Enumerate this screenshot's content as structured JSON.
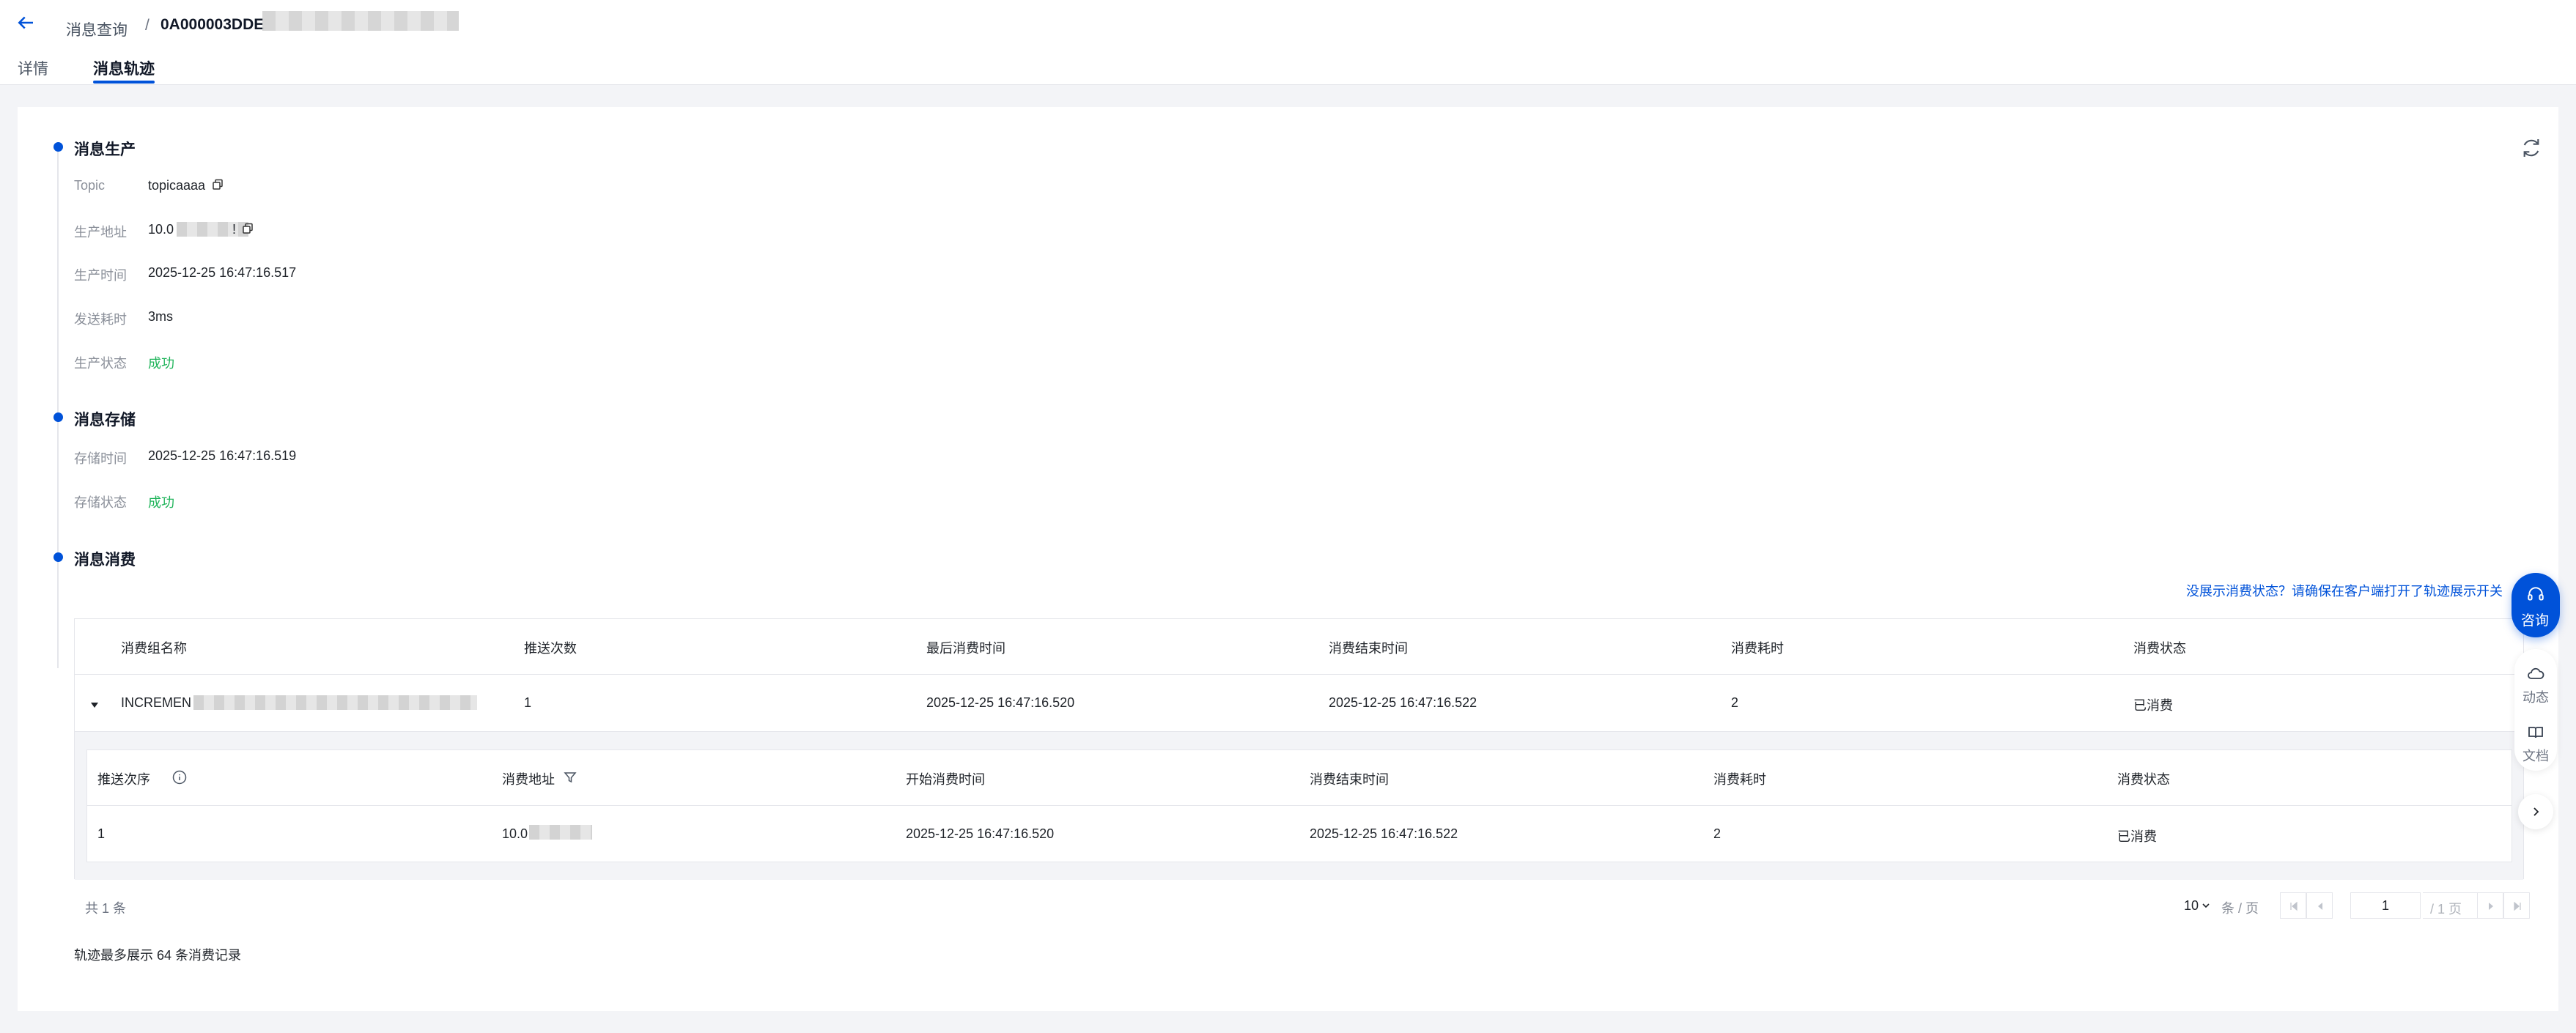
{
  "header": {
    "breadcrumb_parent": "消息查询",
    "breadcrumb_sep": "/",
    "breadcrumb_current": "0A000003DDE",
    "tabs": [
      {
        "label": "详情",
        "active": false
      },
      {
        "label": "消息轨迹",
        "active": true
      }
    ]
  },
  "produce": {
    "title": "消息生产",
    "topic_label": "Topic",
    "topic_value": "topicaaaa",
    "address_label": "生产地址",
    "address_value": "10.0",
    "address_suffix": "!",
    "time_label": "生产时间",
    "time_value": "2025-12-25 16:47:16.517",
    "cost_label": "发送耗时",
    "cost_value": "3ms",
    "status_label": "生产状态",
    "status_value": "成功"
  },
  "store": {
    "title": "消息存储",
    "time_label": "存储时间",
    "time_value": "2025-12-25 16:47:16.519",
    "status_label": "存储状态",
    "status_value": "成功"
  },
  "consume": {
    "title": "消息消费",
    "hint_link": "没展示消费状态？请确保在客户端打开了轨迹展示开关",
    "columns": [
      "消费组名称",
      "推送次数",
      "最后消费时间",
      "消费结束时间",
      "消费耗时",
      "消费状态"
    ],
    "row": {
      "group": "INCREMEN",
      "push_count": "1",
      "last_time": "2025-12-25 16:47:16.520",
      "end_time": "2025-12-25 16:47:16.522",
      "cost": "2",
      "status": "已消费"
    },
    "sub_columns": [
      "推送次序",
      "消费地址",
      "开始消费时间",
      "消费结束时间",
      "消费耗时",
      "消费状态"
    ],
    "sub_row": {
      "order": "1",
      "address": "10.0",
      "start_time": "2025-12-25 16:47:16.520",
      "end_time": "2025-12-25 16:47:16.522",
      "cost": "2",
      "status": "已消费"
    }
  },
  "pager": {
    "total": "共 1 条",
    "page_size": "10",
    "per_page": "条 / 页",
    "current_page": "1",
    "total_pages": "/ 1 页"
  },
  "footnote": "轨迹最多展示 64 条消费记录",
  "side_tools": {
    "consult": "咨询",
    "activity": "动态",
    "docs": "文档"
  },
  "colors": {
    "accent": "#0052d9",
    "success": "#1fb45a"
  }
}
